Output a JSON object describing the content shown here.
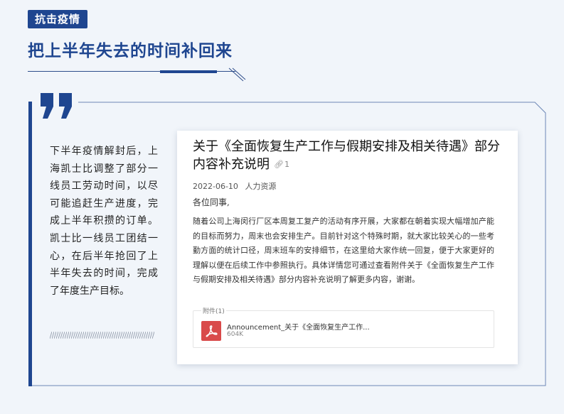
{
  "header": {
    "tag": "抗击疫情",
    "headline": "把上半年失去的时间补回来"
  },
  "story": {
    "text": "下半年疫情解封后，上海凯士比调整了部分一线员工劳动时间，以尽可能追赶生产进度，完成上半年积攒的订单。凯士比一线员工团结一心，在后半年抢回了上半年失去的时间，完成了年度生产目标。"
  },
  "announcement": {
    "title": "关于《全面恢复生产工作与假期安排及相关待遇》部分内容补充说明",
    "attachment_count": "1",
    "date": "2022-06-10",
    "department": "人力资源",
    "greeting": "各位同事,",
    "body": "随着公司上海闵行厂区本周复工复产的活动有序开展，大家都在朝着实现大幅增加产能的目标而努力，周末也会安排生产。目前针对这个特殊时期，就大家比较关心的一些考勤方面的统计口径，周末班车的安排细节，在这里给大家作统一回复，便于大家更好的理解以便在后续工作中参照执行。具体详情您可通过查看附件关于《全面恢复生产工作与假期安排及相关待遇》部分内容补充说明了解更多内容，谢谢。",
    "attachments_label": "附件(1)",
    "file": {
      "name": "Announcement_关于《全面恢复生产工作...",
      "size": "604K",
      "icon": "pdf-icon"
    }
  },
  "colors": {
    "brand": "#1f4690",
    "background": "#f1f5fa",
    "pdf": "#d94a4a"
  }
}
